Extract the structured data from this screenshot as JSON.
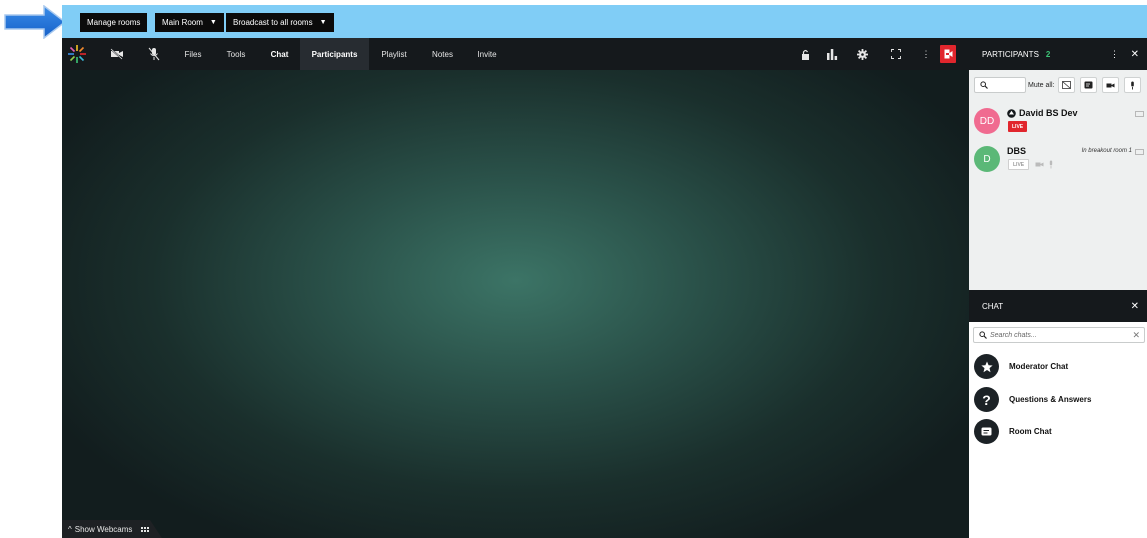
{
  "topbar": {
    "manage_rooms": "Manage rooms",
    "room_select": "Main Room",
    "broadcast": "Broadcast to all rooms",
    "bg_color": "#80cdf6"
  },
  "toolbar": {
    "items": [
      "Files",
      "Tools",
      "Chat",
      "Participants",
      "Playlist",
      "Notes",
      "Invite"
    ],
    "active": "Participants"
  },
  "stage": {
    "show_webcams": "Show Webcams"
  },
  "participants": {
    "header": "PARTICIPANTS",
    "count": "2",
    "mute_all": "Mute all:",
    "list": [
      {
        "initials": "DD",
        "name": "David BS Dev",
        "status": "LIVE",
        "avatar_color": "#f06b90"
      },
      {
        "initials": "D",
        "name": "DBS",
        "status": "LIVE",
        "note": "In breakout room 1",
        "avatar_color": "#5bb877"
      }
    ]
  },
  "chat": {
    "header": "CHAT",
    "search_placeholder": "Search chats...",
    "items": [
      {
        "label": "Moderator Chat",
        "icon": "star-icon"
      },
      {
        "label": "Questions & Answers",
        "icon": "question-icon"
      },
      {
        "label": "Room Chat",
        "icon": "chat-bubble-icon"
      }
    ]
  },
  "colors": {
    "toolbar_bg": "#15191c",
    "leave_button": "#e1262d",
    "live_badge": "#e1262d",
    "count_green": "#3cc476"
  }
}
